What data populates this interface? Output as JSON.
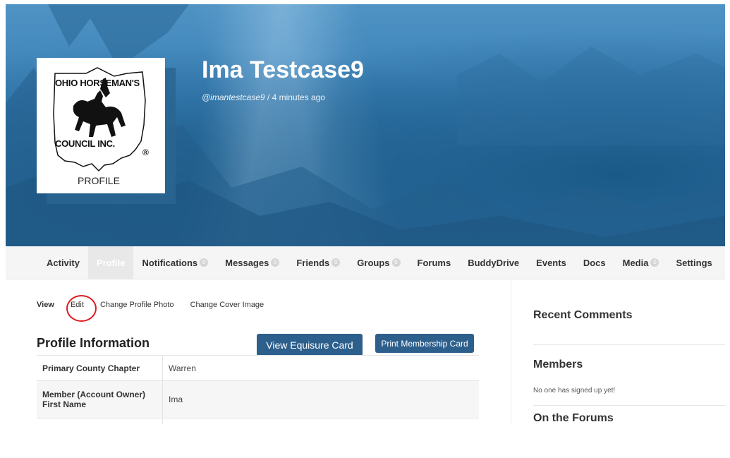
{
  "profile": {
    "name": "Ima Testcase9",
    "handle": "@imantestcase9",
    "meta_separator": " / ",
    "last_active": "4 minutes ago",
    "avatar": {
      "logo_line1": "OHIO HORSEMAN'S",
      "logo_line2": "COUNCIL INC.",
      "logo_caption": "PROFILE",
      "registered_mark": "®"
    }
  },
  "nav": {
    "items": [
      {
        "label": "Activity"
      },
      {
        "label": "Profile",
        "active": true
      },
      {
        "label": "Notifications",
        "count": "0"
      },
      {
        "label": "Messages",
        "count": "0"
      },
      {
        "label": "Friends",
        "count": "0"
      },
      {
        "label": "Groups",
        "count": "0"
      },
      {
        "label": "Forums"
      },
      {
        "label": "BuddyDrive"
      },
      {
        "label": "Events"
      },
      {
        "label": "Docs"
      },
      {
        "label": "Media",
        "count": "0"
      },
      {
        "label": "Settings"
      }
    ]
  },
  "subnav": {
    "view": "View",
    "edit": "Edit",
    "change_photo": "Change Profile Photo",
    "change_cover": "Change Cover Image"
  },
  "profile_info": {
    "title": "Profile Information",
    "view_card_button": "View Equisure Card",
    "print_card_button": "Print Membership Card",
    "rows": [
      {
        "label": "Primary County Chapter",
        "value": "Warren"
      },
      {
        "label": "Member (Account Owner) First Name",
        "value": "Ima"
      },
      {
        "label": "",
        "value": ""
      }
    ]
  },
  "sidebar": {
    "recent_comments_title": "Recent Comments",
    "members_title": "Members",
    "members_empty": "No one has signed up yet!",
    "forums_title": "On the Forums"
  },
  "colors": {
    "button_bg": "#2d5f8c",
    "cover_blue": "#3a80b6",
    "annotation_red": "#e0191f"
  }
}
